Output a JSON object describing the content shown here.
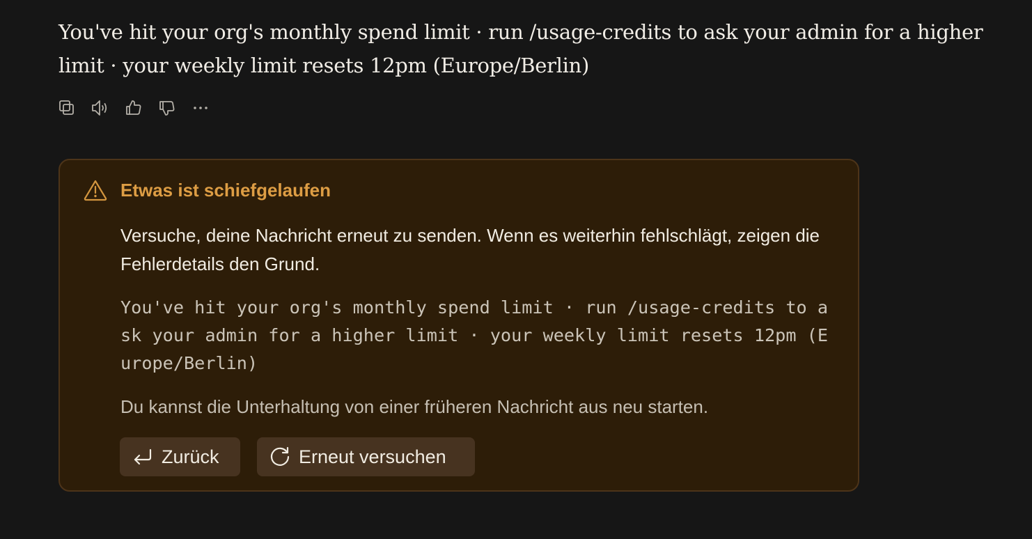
{
  "message": {
    "text": "You've hit your org's monthly spend limit · run /usage-credits to ask your admin for a higher limit · your weekly limit resets 12pm (Europe/Berlin)"
  },
  "message_actions": [
    {
      "icon": "copy-icon"
    },
    {
      "icon": "speaker-icon"
    },
    {
      "icon": "thumbs-up-icon"
    },
    {
      "icon": "thumbs-down-icon"
    },
    {
      "icon": "more-icon"
    }
  ],
  "error": {
    "icon": "warning-icon",
    "title": "Etwas ist schiefgelaufen",
    "description": "Versuche, deine Nachricht erneut zu senden. Wenn es weiterhin fehlschlägt, zeigen die Fehlerdetails den Grund.",
    "code": "You've hit your org's monthly spend limit · run /usage-credits to ask your admin for a higher limit · your weekly limit resets 12pm (Europe/Berlin)",
    "hint": "Du kannst die Unterhaltung von einer früheren Nachricht aus neu starten.",
    "buttons": {
      "back": {
        "label": "Zurück",
        "icon": "return-arrow-icon"
      },
      "retry": {
        "label": "Erneut versuchen",
        "icon": "refresh-icon"
      }
    }
  },
  "colors": {
    "background": "#161616",
    "card_background": "#2d1d08",
    "card_border": "#4d3419",
    "warning_accent": "#dd9d44",
    "button_background": "#473320"
  }
}
